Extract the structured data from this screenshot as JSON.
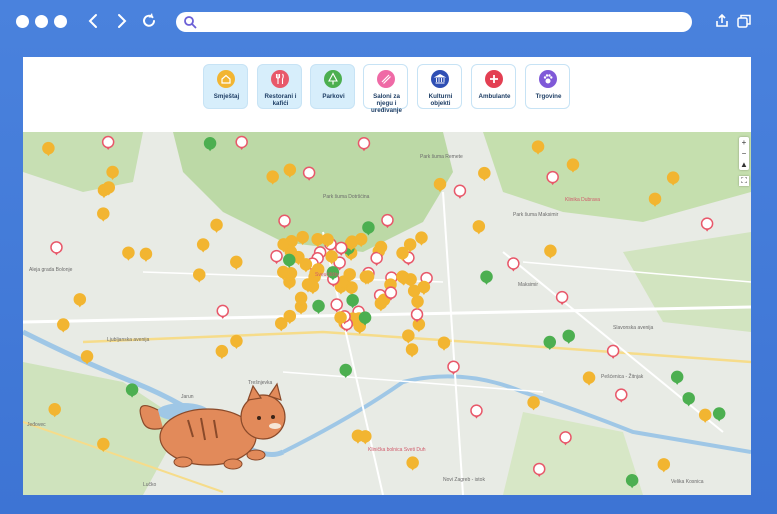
{
  "browser": {
    "url_value": "",
    "icons": [
      "search-icon",
      "share-icon",
      "tabs-icon",
      "back-icon",
      "forward-icon",
      "reload-icon"
    ]
  },
  "categories": [
    {
      "label": "Smještaj",
      "icon": "home-icon",
      "color": "#f2b531",
      "active": true
    },
    {
      "label": "Restorani i kafići",
      "icon": "fork-knife-icon",
      "color": "#e8586a",
      "active": true
    },
    {
      "label": "Parkovi",
      "icon": "tree-icon",
      "color": "#4caf50",
      "active": true
    },
    {
      "label": "Saloni za njegu i uređivanje",
      "icon": "comb-icon",
      "color": "#ef6aa6",
      "active": false
    },
    {
      "label": "Kulturni objekti",
      "icon": "museum-icon",
      "color": "#2f4fb4",
      "active": false
    },
    {
      "label": "Ambulante",
      "icon": "medical-cross-icon",
      "color": "#e33f52",
      "active": false
    },
    {
      "label": "Trgovine",
      "icon": "paw-icon",
      "color": "#7f59d8",
      "active": false
    }
  ],
  "map": {
    "controls": {
      "zoom_in": "+",
      "zoom_out": "−",
      "compass": "▲",
      "fullscreen": "⛶"
    },
    "labels": [
      {
        "text": "Park šuma Remete",
        "red": false
      },
      {
        "text": "Park šuma Maksimir",
        "red": false
      },
      {
        "text": "Park šuma Dotršćina",
        "red": false
      },
      {
        "text": "Aleja grada Bolonje",
        "red": false
      },
      {
        "text": "Ljubljanska avenija",
        "red": false
      },
      {
        "text": "Slavonska avenija",
        "red": false
      },
      {
        "text": "Jarun",
        "red": false
      },
      {
        "text": "Trešnjevka",
        "red": false
      },
      {
        "text": "Maksimir",
        "red": false
      },
      {
        "text": "Pešćenica - Žitnjak",
        "red": false
      },
      {
        "text": "Novi Zagreb - istok",
        "red": false
      },
      {
        "text": "Lučko",
        "red": false
      },
      {
        "text": "Velika Kosnica",
        "red": false
      },
      {
        "text": "Jeđovec",
        "red": false
      },
      {
        "text": "Sveučilište",
        "red": true
      },
      {
        "text": "Klinika Dubrava",
        "red": true
      },
      {
        "text": "Klinička bolnica Sveti Duh",
        "red": true
      }
    ],
    "pin_legend": {
      "yellow": "Smještaj",
      "red": "Restorani i kafići",
      "green": "Parkovi"
    }
  },
  "mascot": {
    "name": "cat-mascot"
  },
  "colors": {
    "browser_blue": "#3d74d4",
    "river": "#9fc7e6",
    "park": "#b9d9a6",
    "road": "#ffffff",
    "major_road": "#f4d77a"
  }
}
